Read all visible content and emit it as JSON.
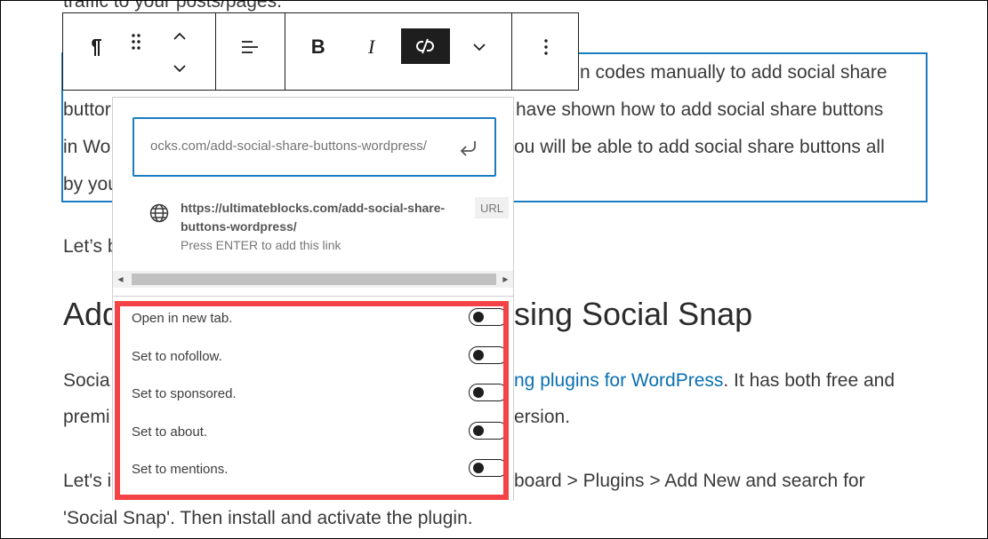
{
  "content": {
    "top_line": "traffic to your posts/pages.",
    "para1": {
      "line1": "n codes manually to add social share",
      "line2_left": "buttor",
      "line2_right": "have shown how to add social share buttons",
      "line3_left": "in Wo",
      "line3_right": "ou will be able to add social share buttons all",
      "line4_left": "by you"
    },
    "lets_left": "Let’s b",
    "heading_left": "Add",
    "heading_right": "sing Social Snap",
    "para3": {
      "line1_left": "Socia",
      "line1_link": "ng plugins for WordPress",
      "line1_right": ". It has both free and",
      "line2_left": "premi",
      "line2_right": "ersion."
    },
    "para4": {
      "line1_left": "Let's i",
      "line1_right": "board > Plugins > Add New and search for",
      "line2": "'Social Snap'. Then install and activate the plugin."
    }
  },
  "toolbar": {
    "paragraph_icon": "pilcrow-icon",
    "drag_icon": "drag-handle-icon",
    "move_up_icon": "chevron-up-icon",
    "move_down_icon": "chevron-down-icon",
    "align_icon": "align-left-icon",
    "bold_icon": "bold-icon",
    "italic_icon": "italic-icon",
    "link_icon": "link-off-icon",
    "more_rich_icon": "chevron-down-icon",
    "options_icon": "vertical-ellipsis-icon",
    "active_color": "#1e1e1e"
  },
  "link_popover": {
    "input_value": "ocks.com/add-social-share-buttons-wordpress/",
    "submit_icon": "return-arrow-icon",
    "suggestion": {
      "icon": "globe-icon",
      "url": "https://ultimateblocks.com/add-social-share-buttons-wordpress/",
      "hint": "Press ENTER to add this link",
      "badge": "URL"
    }
  },
  "settings": [
    {
      "label": "Open in new tab.",
      "checked": false
    },
    {
      "label": "Set to nofollow.",
      "checked": false
    },
    {
      "label": "Set to sponsored.",
      "checked": false
    },
    {
      "label": "Set to about.",
      "checked": false
    },
    {
      "label": "Set to mentions.",
      "checked": false
    }
  ],
  "colors": {
    "accent": "#1a7cc1",
    "highlight": "#f44346",
    "link": "#0a6fb0"
  }
}
